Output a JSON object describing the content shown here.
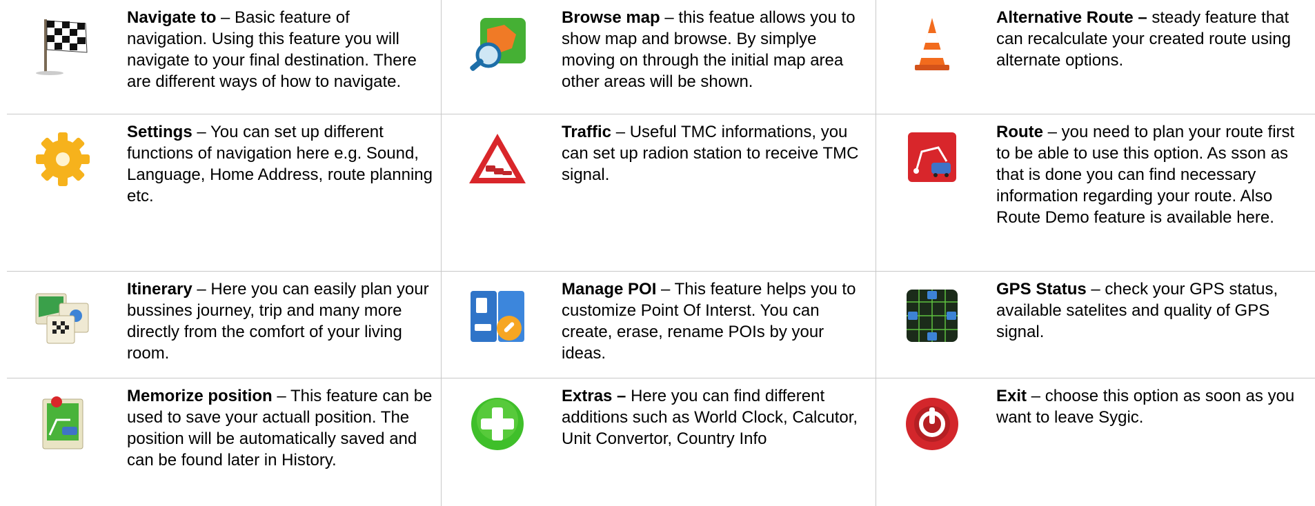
{
  "features": [
    {
      "title": "Navigate to",
      "body": " – Basic feature of navigation. Using this feature you will navigate to your final destination. There are different ways of how to  navigate.",
      "icon": "checkered-flag-icon"
    },
    {
      "title": "Browse map",
      "body": " – this featue allows you to show map and browse. By simplye moving on through the initial map area other areas will be shown.",
      "icon": "map-magnifier-icon"
    },
    {
      "title": "Alternative Route –",
      "body": " steady feature that can recalculate your created route using alternate options.",
      "icon": "traffic-cone-icon"
    },
    {
      "title": "Settings",
      "body": " – You can set up different functions of navigation here e.g. Sound, Language, Home Address, route planning etc.",
      "icon": "gear-icon"
    },
    {
      "title": "Traffic",
      "body": " – Useful TMC informations, you can set up radion station to receive TMC signal.",
      "icon": "traffic-warning-icon"
    },
    {
      "title": "Route",
      "body": " – you need to plan your route first to be able to use this option. As sson as that is done you can find necessary information regarding your  route. Also Route Demo feature is  available here.",
      "icon": "route-icon"
    },
    {
      "title": "Itinerary",
      "body": "  – Here you can easily plan your bussines journey, trip and many more directly from the comfort of your living room.",
      "icon": "itinerary-icon"
    },
    {
      "title": "Manage POI",
      "body": " – This feature helps you to customize Point Of Interst. You can create, erase, rename POIs by your ideas.",
      "icon": "poi-manage-icon"
    },
    {
      "title": "GPS Status",
      "body": " – check your GPS status, available satelites and quality of GPS signal.",
      "icon": "gps-compass-icon"
    },
    {
      "title": "Memorize position",
      "body": "  – This feature can be used to save your actuall position. The position will be automatically saved and can be  found later in History.",
      "icon": "memorize-pin-icon"
    },
    {
      "title": "Extras –",
      "body": " Here you can find different additions such as World Clock, Calcutor, Unit Convertor, Country Info",
      "icon": "plus-circle-icon"
    },
    {
      "title": "Exit",
      "body": " – choose this option as soon as you want to leave Sygic.",
      "icon": "power-button-icon"
    }
  ]
}
